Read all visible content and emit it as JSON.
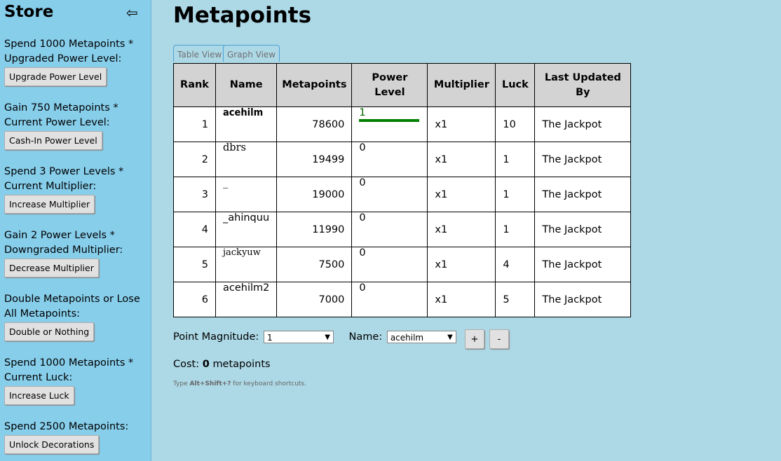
{
  "sidebar": {
    "title": "Store",
    "back_icon": "left-arrow-icon",
    "items": [
      {
        "desc": "Spend 1000 Metapoints * Upgraded Power Level:",
        "button": "Upgrade Power Level"
      },
      {
        "desc": "Gain 750 Metapoints * Current Power Level:",
        "button": "Cash-In Power Level"
      },
      {
        "desc": "Spend 3 Power Levels * Current Multiplier:",
        "button": "Increase Multiplier"
      },
      {
        "desc": "Gain 2 Power Levels * Downgraded Multiplier:",
        "button": "Decrease Multiplier"
      },
      {
        "desc": "Double Metapoints or Lose All Metapoints:",
        "button": "Double or Nothing"
      },
      {
        "desc": "Spend 1000 Metapoints * Current Luck:",
        "button": "Increase Luck"
      },
      {
        "desc": "Spend 2500 Metapoints:",
        "button": "Unlock Decorations"
      }
    ]
  },
  "main": {
    "title": "Metapoints",
    "tabs": [
      "Table View",
      "Graph View"
    ]
  },
  "table": {
    "headers": [
      "Rank",
      "Name",
      "Metapoints",
      "Power Level",
      "Multiplier",
      "Luck",
      "Last Updated By"
    ],
    "rows": [
      {
        "rank": "1",
        "name": "acehilm",
        "metapoints": "78600",
        "power": "1",
        "multiplier": "x1",
        "luck": "10",
        "updated": "The Jackpot"
      },
      {
        "rank": "2",
        "name": "dbrs",
        "metapoints": "19499",
        "power": "0",
        "multiplier": "x1",
        "luck": "1",
        "updated": "The Jackpot"
      },
      {
        "rank": "3",
        "name": "_",
        "metapoints": "19000",
        "power": "0",
        "multiplier": "x1",
        "luck": "1",
        "updated": "The Jackpot"
      },
      {
        "rank": "4",
        "name": "_ahinquu",
        "metapoints": "11990",
        "power": "0",
        "multiplier": "x1",
        "luck": "1",
        "updated": "The Jackpot"
      },
      {
        "rank": "5",
        "name": "jackyuw",
        "metapoints": "7500",
        "power": "0",
        "multiplier": "x1",
        "luck": "4",
        "updated": "The Jackpot"
      },
      {
        "rank": "6",
        "name": "acehilm2",
        "metapoints": "7000",
        "power": "0",
        "multiplier": "x1",
        "luck": "5",
        "updated": "The Jackpot"
      }
    ]
  },
  "controls": {
    "magnitude_label": "Point Magnitude:",
    "magnitude_value": "1",
    "name_label": "Name:",
    "name_value": "acehilm",
    "plus_label": "+",
    "minus_label": "-",
    "cost_prefix": "Cost:",
    "cost_value": "0",
    "cost_suffix": "metapoints",
    "hint_prefix": "Type",
    "hint_keys": "Alt+Shift+?",
    "hint_suffix": "for keyboard shortcuts."
  },
  "colors": {
    "sidebar_bg": "#87ceeb",
    "page_bg": "#add8e6",
    "highlight_blue": "#0000cc",
    "highlight_green": "#90ee90",
    "power_bar": "#008000"
  }
}
